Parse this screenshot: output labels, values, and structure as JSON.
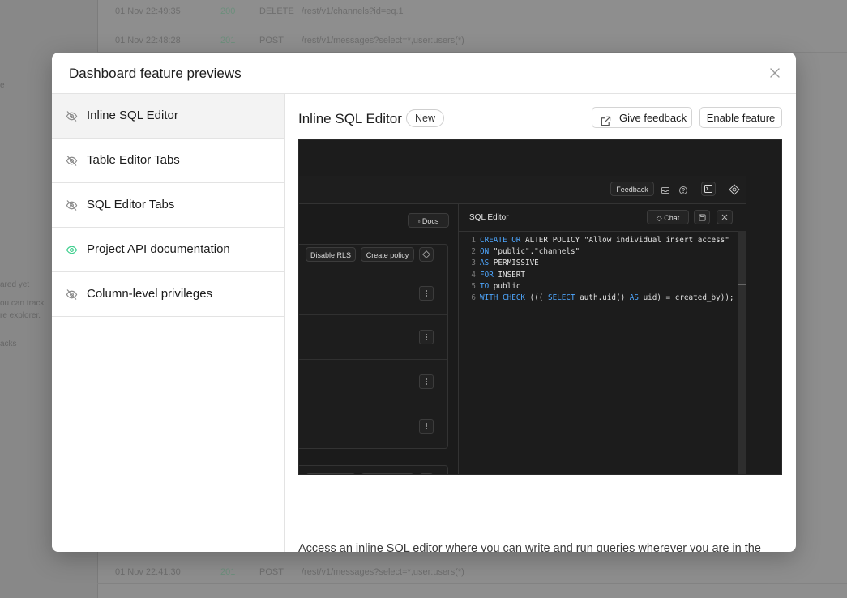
{
  "background": {
    "rows": [
      {
        "date": "01 Nov 22:49:35",
        "status": "200",
        "method": "DELETE",
        "path": "/rest/v1/channels?id=eq.1"
      },
      {
        "date": "01 Nov 22:48:28",
        "status": "201",
        "method": "POST",
        "path": "/rest/v1/messages?select=*,user:users(*)"
      },
      {
        "date": "01 Nov 22:41:30",
        "status": "201",
        "method": "POST",
        "path": "/rest/v1/messages?select=*,user:users(*)"
      }
    ]
  },
  "modal": {
    "title": "Dashboard feature previews",
    "close_icon": "close-icon"
  },
  "nav": {
    "items": [
      {
        "label": "Inline SQL Editor",
        "icon": "eye-off-icon",
        "active": true
      },
      {
        "label": "Table Editor Tabs",
        "icon": "eye-off-icon",
        "active": false
      },
      {
        "label": "SQL Editor Tabs",
        "icon": "eye-off-icon",
        "active": false
      },
      {
        "label": "Project API documentation",
        "icon": "eye-icon",
        "active": false
      },
      {
        "label": "Column-level privileges",
        "icon": "eye-off-icon",
        "active": false
      }
    ]
  },
  "feature": {
    "title": "Inline SQL Editor",
    "badge": "New",
    "feedback_label": "Give feedback",
    "enable_label": "Enable feature",
    "description": "Access an inline SQL editor where you can write and run queries wherever you are in the dashboard. Use the inline Assistant to generate or modify queries without leaving the editor."
  },
  "preview": {
    "feedback": "Feedback",
    "docs": "Docs",
    "disable_rls": "Disable RLS",
    "create_policy": "Create policy",
    "editor_title": "SQL Editor",
    "chat": "Chat",
    "code_lines": [
      {
        "n": "1",
        "tokens": [
          [
            "kw",
            "CREATE"
          ],
          [
            "t",
            " "
          ],
          [
            "kw",
            "OR"
          ],
          [
            "t",
            " ALTER POLICY \"Allow individual insert access\""
          ]
        ]
      },
      {
        "n": "2",
        "tokens": [
          [
            "kw",
            "ON"
          ],
          [
            "t",
            " \"public\".\"channels\""
          ]
        ]
      },
      {
        "n": "3",
        "tokens": [
          [
            "kw",
            "AS"
          ],
          [
            "t",
            " PERMISSIVE"
          ]
        ]
      },
      {
        "n": "4",
        "tokens": [
          [
            "kw",
            "FOR"
          ],
          [
            "t",
            " INSERT"
          ]
        ]
      },
      {
        "n": "5",
        "tokens": [
          [
            "kw",
            "TO"
          ],
          [
            "t",
            " public"
          ]
        ]
      },
      {
        "n": "6",
        "tokens": [
          [
            "kw",
            "WITH"
          ],
          [
            "t",
            " "
          ],
          [
            "kw",
            "CHECK"
          ],
          [
            "t",
            " ((( "
          ],
          [
            "kw",
            "SELECT"
          ],
          [
            "t",
            " auth.uid() "
          ],
          [
            "kw",
            "AS"
          ],
          [
            "t",
            " uid) = created_by));"
          ]
        ]
      }
    ]
  },
  "colors": {
    "eye_on": "#3ecf8e",
    "eye_off": "#8a8a8a",
    "sql_keyword": "#4ea7ff"
  }
}
